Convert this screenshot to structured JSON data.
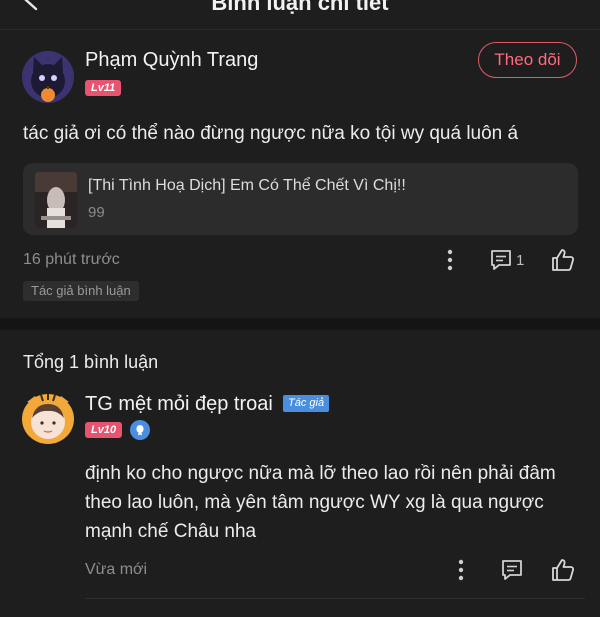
{
  "header": {
    "title": "Bình luận chi tiết",
    "back_icon": "arrow-left-icon"
  },
  "post": {
    "user_name": "Phạm Quỳnh Trang",
    "level": "Lv11",
    "follow_label": "Theo dõi",
    "text": "tác giả ơi có thể nào đừng ngược nữa ko tội wy quá luôn á",
    "book": {
      "title": "[Thi Tình Hoạ Dịch] Em Có Thể Chết Vì Chị!!",
      "subtitle": "99"
    },
    "time": "16 phút trước",
    "reply_count": "1",
    "tag": "Tác giả bình luận"
  },
  "replies": {
    "total_label": "Tổng 1 bình luận",
    "items": [
      {
        "user_name": "TG mệt mỏi đẹp troai",
        "author_tag": "Tác giả",
        "level": "Lv10",
        "text_lines": [
          "định ko cho ngược nữa mà lỡ theo lao rồi nên phải đâm",
          "theo lao luôn, mà yên tâm ngược WY xg là qua ngược",
          "mạnh chế Châu nha"
        ],
        "time": "Vừa mới"
      }
    ]
  },
  "colors": {
    "accent": "#ff6b7e",
    "level_badge": "#e8546f",
    "author_badge": "#4a8fdf",
    "background": "#1e1e1e"
  }
}
